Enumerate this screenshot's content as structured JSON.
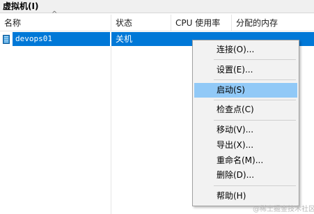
{
  "section": {
    "title": "虚拟机(I)"
  },
  "columns": [
    "名称",
    "状态",
    "CPU 使用率",
    "分配的内存"
  ],
  "vm_row": {
    "name": "devops01",
    "state": "关机"
  },
  "context_menu": {
    "items": [
      "连接(O)...",
      "设置(E)...",
      "启动(S)",
      "检查点(C)",
      "移动(V)...",
      "导出(X)...",
      "重命名(M)...",
      "删除(D)...",
      "帮助(H)"
    ],
    "highlighted": "启动(S)"
  },
  "watermark": "@稀土掘金技术社区",
  "colors": {
    "selection": "#0078d7",
    "menu_hover": "#91c9f7",
    "menu_bg": "#f2f2f2"
  },
  "icons": {
    "vm": "virtual-machine-icon",
    "sort": "sort-ascending-icon"
  }
}
